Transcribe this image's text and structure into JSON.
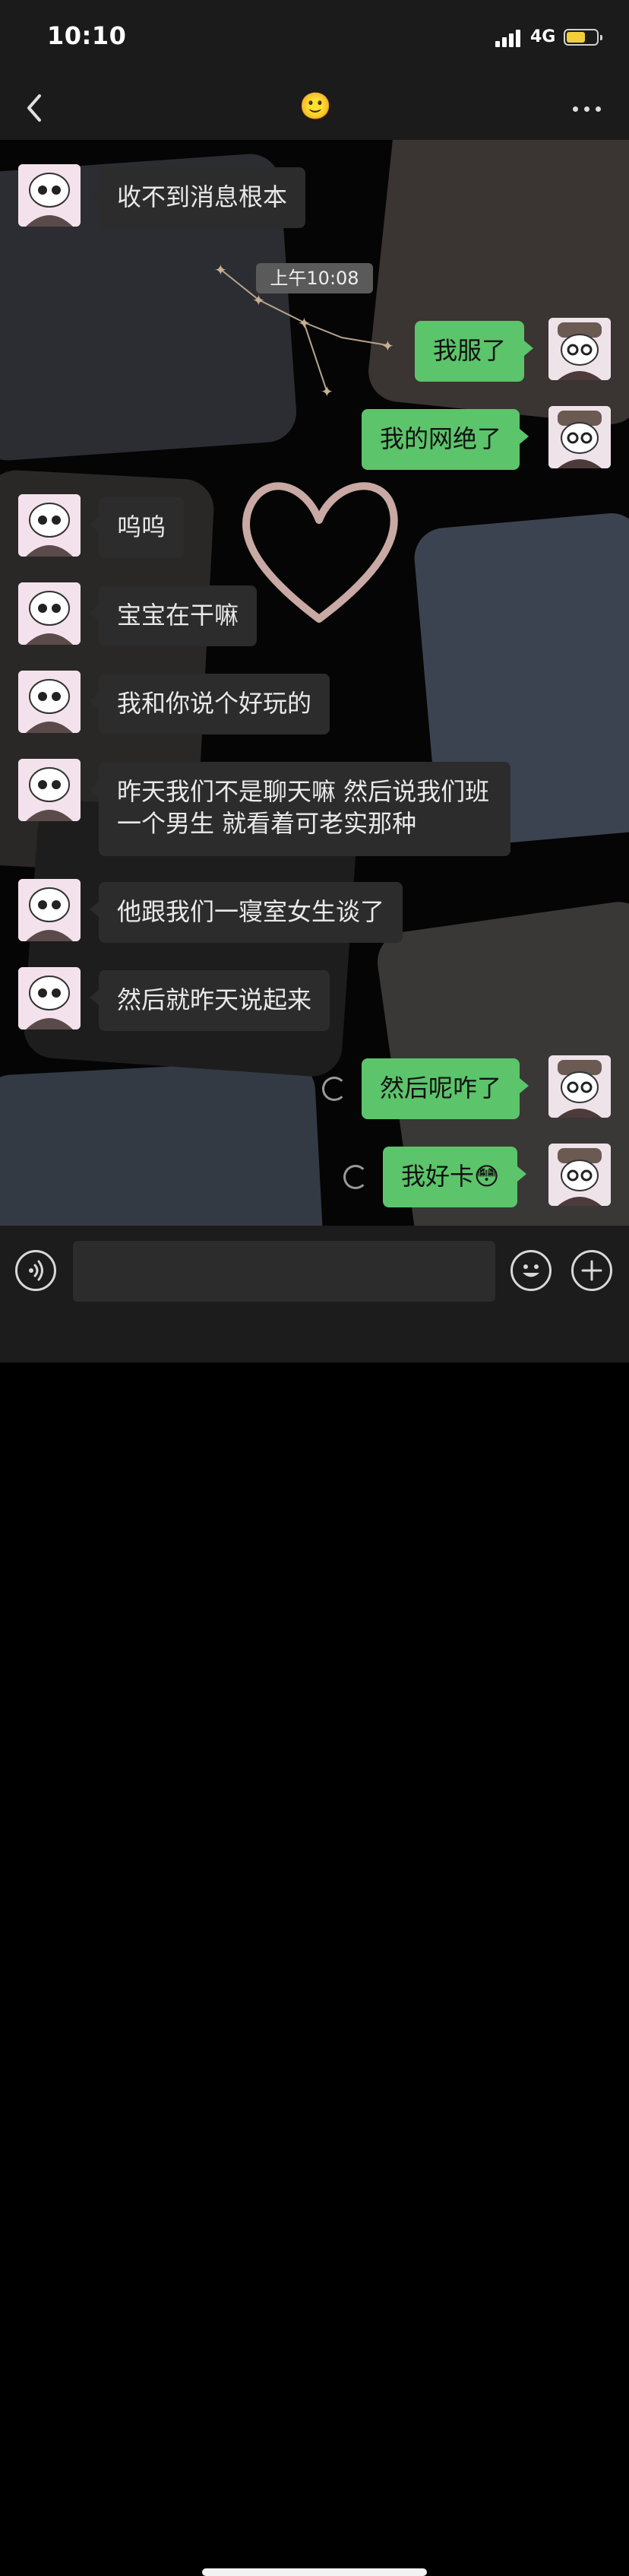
{
  "status_bar": {
    "time": "10:10",
    "network": "4G"
  },
  "nav": {
    "title_emoji": "🙂"
  },
  "timestamp": "上午10:08",
  "messages": [
    {
      "side": "in",
      "text": "收不到消息根本"
    },
    {
      "side": "out",
      "text": "我服了"
    },
    {
      "side": "out",
      "text": "我的网绝了"
    },
    {
      "side": "in",
      "text": "呜呜"
    },
    {
      "side": "in",
      "text": "宝宝在干嘛"
    },
    {
      "side": "in",
      "text": "我和你说个好玩的"
    },
    {
      "side": "in",
      "text": "昨天我们不是聊天嘛 然后说我们班一个男生 就看着可老实那种"
    },
    {
      "side": "in",
      "text": "他跟我们一寝室女生谈了"
    },
    {
      "side": "in",
      "text": "然后就昨天说起来"
    },
    {
      "side": "out",
      "text": "然后呢咋了"
    },
    {
      "side": "out",
      "text": "我好卡😳"
    }
  ],
  "input": {
    "placeholder": ""
  },
  "icons": {
    "back": "chevron-left-icon",
    "more": "more-dots-icon",
    "voice": "voice-icon",
    "emoji": "smiley-icon",
    "plus": "plus-icon"
  },
  "colors": {
    "outgoing_bubble": "#5cc46a",
    "incoming_bubble": "#2c2c2c",
    "battery": "#f2cf3a"
  }
}
